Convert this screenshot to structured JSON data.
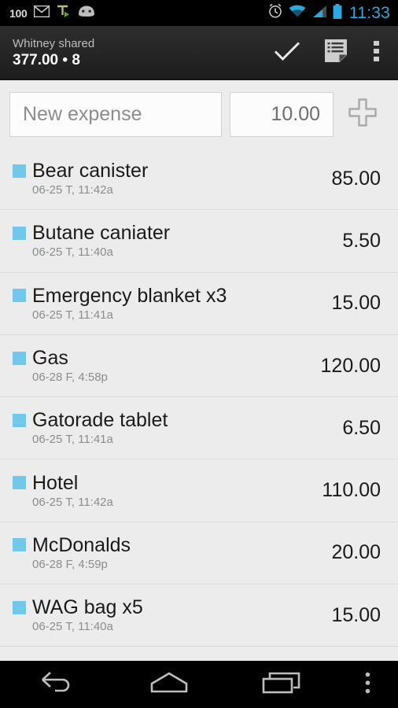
{
  "statusbar": {
    "battery_text": "100",
    "time": "11:33",
    "time_color": "#2aa9e0",
    "left_icons": [
      "battery-100-text",
      "gmail-icon",
      "tasker-icon",
      "android-head-icon"
    ],
    "right_icons": [
      "alarm-clock-icon",
      "wifi-icon",
      "cell-signal-icon",
      "battery-icon"
    ]
  },
  "actionbar": {
    "subtitle": "Whitney shared",
    "title": "377.00 • 8",
    "actions": [
      {
        "name": "check-icon",
        "label": "Done"
      },
      {
        "name": "notes-icon",
        "label": "Notes"
      },
      {
        "name": "overflow-menu-icon",
        "label": "More options"
      }
    ]
  },
  "input_row": {
    "name_placeholder": "New expense",
    "name_value": "",
    "amount_value": "10.00",
    "add_button": "add-expense-icon"
  },
  "expenses": {
    "accent_color": "#72c8e8",
    "items": [
      {
        "title": "Bear canister",
        "date": "06-25 T, 11:42a",
        "amount": "85.00"
      },
      {
        "title": "Butane caniater",
        "date": "06-25 T, 11:40a",
        "amount": "5.50"
      },
      {
        "title": "Emergency blanket x3",
        "date": "06-25 T, 11:41a",
        "amount": "15.00"
      },
      {
        "title": "Gas",
        "date": "06-28 F, 4:58p",
        "amount": "120.00"
      },
      {
        "title": "Gatorade tablet",
        "date": "06-25 T, 11:41a",
        "amount": "6.50"
      },
      {
        "title": "Hotel",
        "date": "06-25 T, 11:42a",
        "amount": "110.00"
      },
      {
        "title": "McDonalds",
        "date": "06-28 F, 4:59p",
        "amount": "20.00"
      },
      {
        "title": "WAG bag x5",
        "date": "06-25 T, 11:40a",
        "amount": "15.00"
      }
    ]
  },
  "navbar": {
    "buttons": [
      {
        "name": "back-icon",
        "label": "Back"
      },
      {
        "name": "home-icon",
        "label": "Home"
      },
      {
        "name": "recents-icon",
        "label": "Recent apps"
      },
      {
        "name": "overflow-menu-icon",
        "label": "Menu"
      }
    ]
  }
}
